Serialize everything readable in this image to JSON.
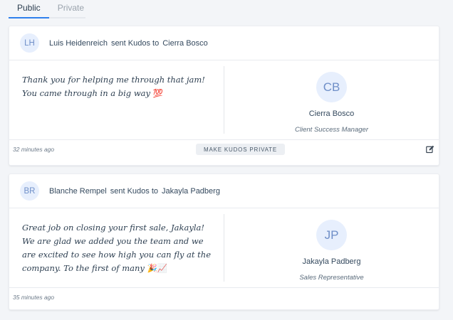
{
  "tabs": [
    {
      "label": "Public",
      "active": true
    },
    {
      "label": "Private",
      "active": false
    }
  ],
  "kudos": [
    {
      "sender_initials": "LH",
      "sender_name": "Luis Heidenreich",
      "sent_text": "sent Kudos to",
      "recipient_name": "Cierra Bosco",
      "message": "Thank you for helping me through that jam! You came through in a big way",
      "message_emoji": "💯",
      "recipient_initials": "CB",
      "recipient_title": "Client Success Manager",
      "timestamp": "32 minutes ago",
      "make_private_label": "MAKE KUDOS PRIVATE"
    },
    {
      "sender_initials": "BR",
      "sender_name": "Blanche Rempel",
      "sent_text": "sent Kudos to",
      "recipient_name": "Jakayla Padberg",
      "message": "Great job on closing your first sale, Jakayla! We are glad we added you the team and we are excited to see how high you can fly at the company. To the first of many",
      "message_emoji": "🎉📈",
      "recipient_initials": "JP",
      "recipient_title": "Sales Representative",
      "timestamp": "35 minutes ago"
    }
  ],
  "colors": {
    "accent": "#2f80ed",
    "avatar_bg": "#e7effd",
    "avatar_text": "#6f8fc8"
  }
}
